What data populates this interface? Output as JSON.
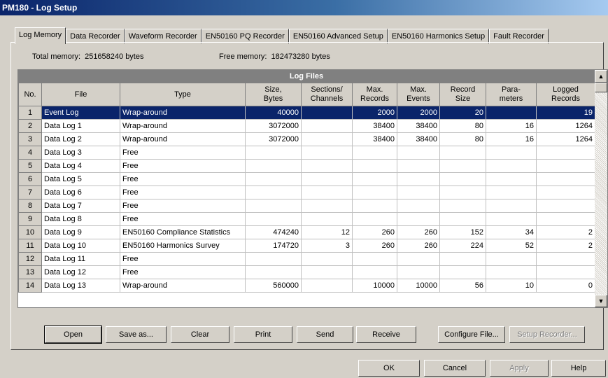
{
  "window": {
    "title": "PM180 - Log Setup"
  },
  "tabs": [
    {
      "label": "Log Memory",
      "active": true
    },
    {
      "label": "Data Recorder"
    },
    {
      "label": "Waveform Recorder"
    },
    {
      "label": "EN50160 PQ Recorder"
    },
    {
      "label": "EN50160 Advanced Setup"
    },
    {
      "label": "EN50160 Harmonics Setup"
    },
    {
      "label": "Fault Recorder"
    }
  ],
  "memory": {
    "total_label": "Total memory:",
    "total_value": "251658240 bytes",
    "free_label": "Free memory:",
    "free_value": "182473280 bytes"
  },
  "grid": {
    "title": "Log Files",
    "columns": [
      "No.",
      "File",
      "Type",
      "Size,\nBytes",
      "Sections/\nChannels",
      "Max.\nRecords",
      "Max.\nEvents",
      "Record\nSize",
      "Para-\nmeters",
      "Logged\nRecords"
    ],
    "selected_row": 0,
    "rows": [
      [
        "1",
        "Event Log",
        "Wrap-around",
        "40000",
        "",
        "2000",
        "2000",
        "20",
        "",
        "19"
      ],
      [
        "2",
        "Data Log 1",
        "Wrap-around",
        "3072000",
        "",
        "38400",
        "38400",
        "80",
        "16",
        "1264"
      ],
      [
        "3",
        "Data Log 2",
        "Wrap-around",
        "3072000",
        "",
        "38400",
        "38400",
        "80",
        "16",
        "1264"
      ],
      [
        "4",
        "Data Log 3",
        "Free",
        "",
        "",
        "",
        "",
        "",
        "",
        ""
      ],
      [
        "5",
        "Data Log 4",
        "Free",
        "",
        "",
        "",
        "",
        "",
        "",
        ""
      ],
      [
        "6",
        "Data Log 5",
        "Free",
        "",
        "",
        "",
        "",
        "",
        "",
        ""
      ],
      [
        "7",
        "Data Log 6",
        "Free",
        "",
        "",
        "",
        "",
        "",
        "",
        ""
      ],
      [
        "8",
        "Data Log 7",
        "Free",
        "",
        "",
        "",
        "",
        "",
        "",
        ""
      ],
      [
        "9",
        "Data Log 8",
        "Free",
        "",
        "",
        "",
        "",
        "",
        "",
        ""
      ],
      [
        "10",
        "Data Log 9",
        "EN50160 Compliance Statistics",
        "474240",
        "12",
        "260",
        "260",
        "152",
        "34",
        "2"
      ],
      [
        "11",
        "Data Log 10",
        "EN50160 Harmonics Survey",
        "174720",
        "3",
        "260",
        "260",
        "224",
        "52",
        "2"
      ],
      [
        "12",
        "Data Log 11",
        "Free",
        "",
        "",
        "",
        "",
        "",
        "",
        ""
      ],
      [
        "13",
        "Data Log 12",
        "Free",
        "",
        "",
        "",
        "",
        "",
        "",
        ""
      ],
      [
        "14",
        "Data Log 13",
        "Wrap-around",
        "560000",
        "",
        "10000",
        "10000",
        "56",
        "10",
        "0"
      ]
    ]
  },
  "buttons": {
    "open": "Open",
    "save_as": "Save as...",
    "clear": "Clear",
    "print": "Print",
    "send": "Send",
    "receive": "Receive",
    "configure_file": "Configure File...",
    "setup_recorder": "Setup Recorder...",
    "ok": "OK",
    "cancel": "Cancel",
    "apply": "Apply",
    "help": "Help"
  },
  "icons": {
    "scroll_up": "scroll-up-arrow-icon",
    "scroll_down": "scroll-down-arrow-icon"
  },
  "colors": {
    "selection": "#0a246a",
    "title_gradient_start": "#0a246a",
    "face": "#d4d0c8"
  }
}
